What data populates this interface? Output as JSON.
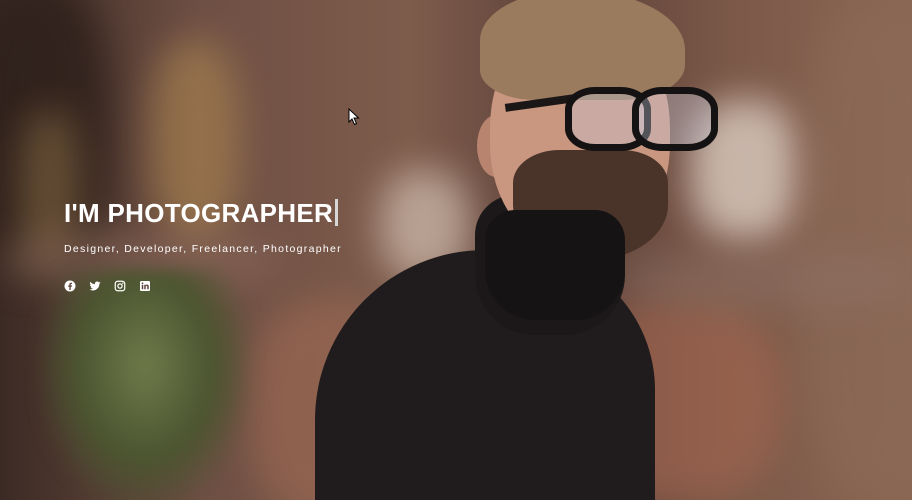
{
  "hero": {
    "title": "I'M PHOTOGRAPHER",
    "subtitle": "Designer, Developer, Freelancer, Photographer",
    "social": [
      {
        "icon": "facebook-icon"
      },
      {
        "icon": "twitter-icon"
      },
      {
        "icon": "instagram-icon"
      },
      {
        "icon": "linkedin-icon"
      }
    ]
  },
  "colors": {
    "text": "#ffffff",
    "typing_cursor": "#d7d7d7"
  }
}
